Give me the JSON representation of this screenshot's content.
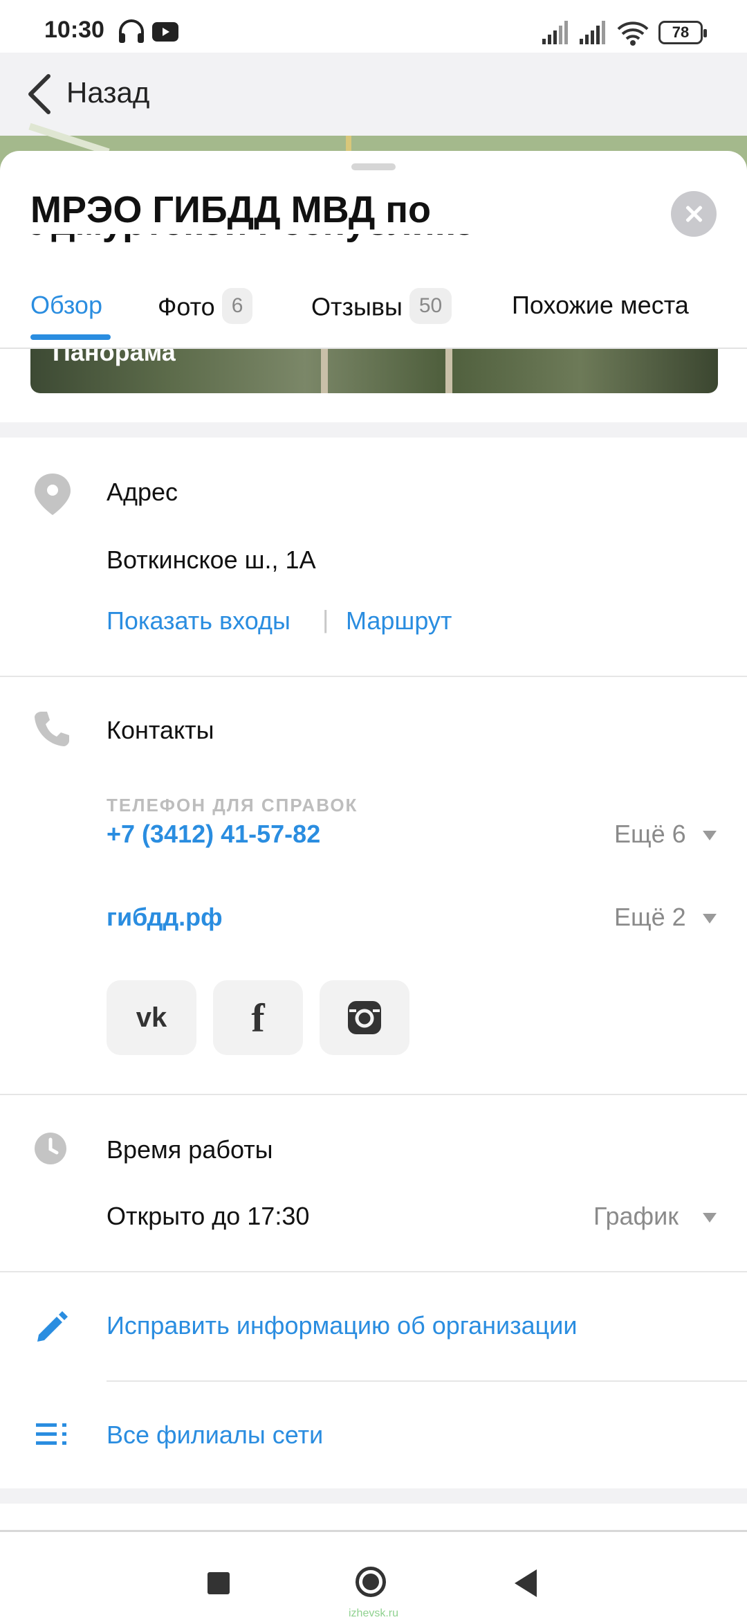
{
  "status_bar": {
    "time": "10:30",
    "battery": "78",
    "icons": [
      "headphones-icon",
      "youtube-icon",
      "signal-icon",
      "signal-icon",
      "wifi-icon",
      "battery-icon"
    ]
  },
  "nav": {
    "back_label": "Назад"
  },
  "place": {
    "title": "МРЭО ГИБДД МВД по",
    "title_second_line": "Удмуртской Республике"
  },
  "tabs": [
    {
      "label": "Обзор",
      "badge": null,
      "active": true
    },
    {
      "label": "Фото",
      "badge": "6",
      "active": false
    },
    {
      "label": "Отзывы",
      "badge": "50",
      "active": false
    },
    {
      "label": "Похожие места",
      "badge": null,
      "active": false
    }
  ],
  "panorama": {
    "label": "Панорама"
  },
  "address": {
    "title": "Адрес",
    "value": "Воткинское ш., 1А",
    "show_entrances": "Показать входы",
    "separator": "|",
    "route": "Маршрут"
  },
  "contacts": {
    "title": "Контакты",
    "phone_caption": "ТЕЛЕФОН ДЛЯ СПРАВОК",
    "phone": "+7 (3412) 41-57-82",
    "phone_more": "Ещё 6",
    "site": "гибдд.рф",
    "site_more": "Ещё 2",
    "socials": [
      "vk",
      "f",
      "instagram"
    ]
  },
  "hours": {
    "title": "Время работы",
    "value": "Открыто до 17:30",
    "schedule": "График"
  },
  "actions": {
    "edit_info": "Исправить информацию об организации",
    "all_branches": "Все филиалы сети"
  },
  "watermark": "izhevsk.ru",
  "colors": {
    "accent": "#2a8de0",
    "muted": "#8a8a8a",
    "icon_gray": "#c4c4c4"
  }
}
